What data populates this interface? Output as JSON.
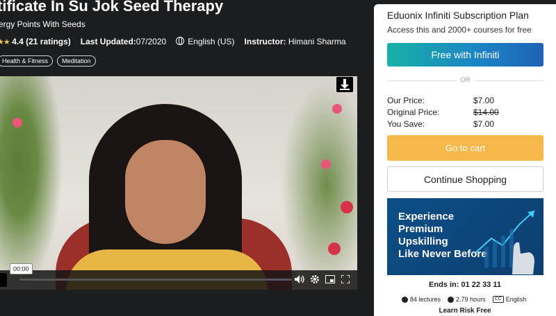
{
  "header": {
    "title": "tificate In Su Jok Seed Therapy",
    "subtitle": "ergy Points With Seeds",
    "rating": "4.4 (21 ratings)",
    "last_updated_label": "Last Updated:",
    "last_updated_value": "07/2020",
    "language": "English (US)",
    "instructor_label": "Instructor:",
    "instructor_name": "Himani Sharma",
    "tags": [
      "Health & Fitness",
      "Meditation"
    ]
  },
  "video": {
    "time_tooltip": "00:00",
    "controls": [
      "download-icon",
      "volume-icon",
      "settings-icon",
      "picture-in-picture-icon",
      "fullscreen-icon"
    ]
  },
  "sidebar": {
    "plan_title": "Eduonix Infiniti Subscription Plan",
    "plan_subtitle": "Access this and 2000+ courses for free",
    "infiniti_button": "Free with Infiniti",
    "or_label": "OR",
    "our_price_label": "Our Price:",
    "our_price": "$7.00",
    "original_price_label": "Original Price:",
    "original_price": "$14.00",
    "you_save_label": "You Save:",
    "you_save": "$7.00",
    "cart_button": "Go to cart",
    "continue_button": "Continue Shopping",
    "banner_text": "Experience\nPremium\nUpskilling\nLike Never Before",
    "ends_in": "Ends in: 01 22 33 11",
    "lectures": "84 lectures",
    "hours": "2.79 hours",
    "language": "English",
    "risk_free": "Learn Risk Free"
  },
  "colors": {
    "page_bg": "#1c1d1f",
    "cart_button": "#f7b84b",
    "infiniti_gradient_start": "#19b1a6",
    "infiniti_gradient_end": "#1f62b6",
    "banner_bg": "#0c4f86",
    "star": "#f5c04d"
  }
}
